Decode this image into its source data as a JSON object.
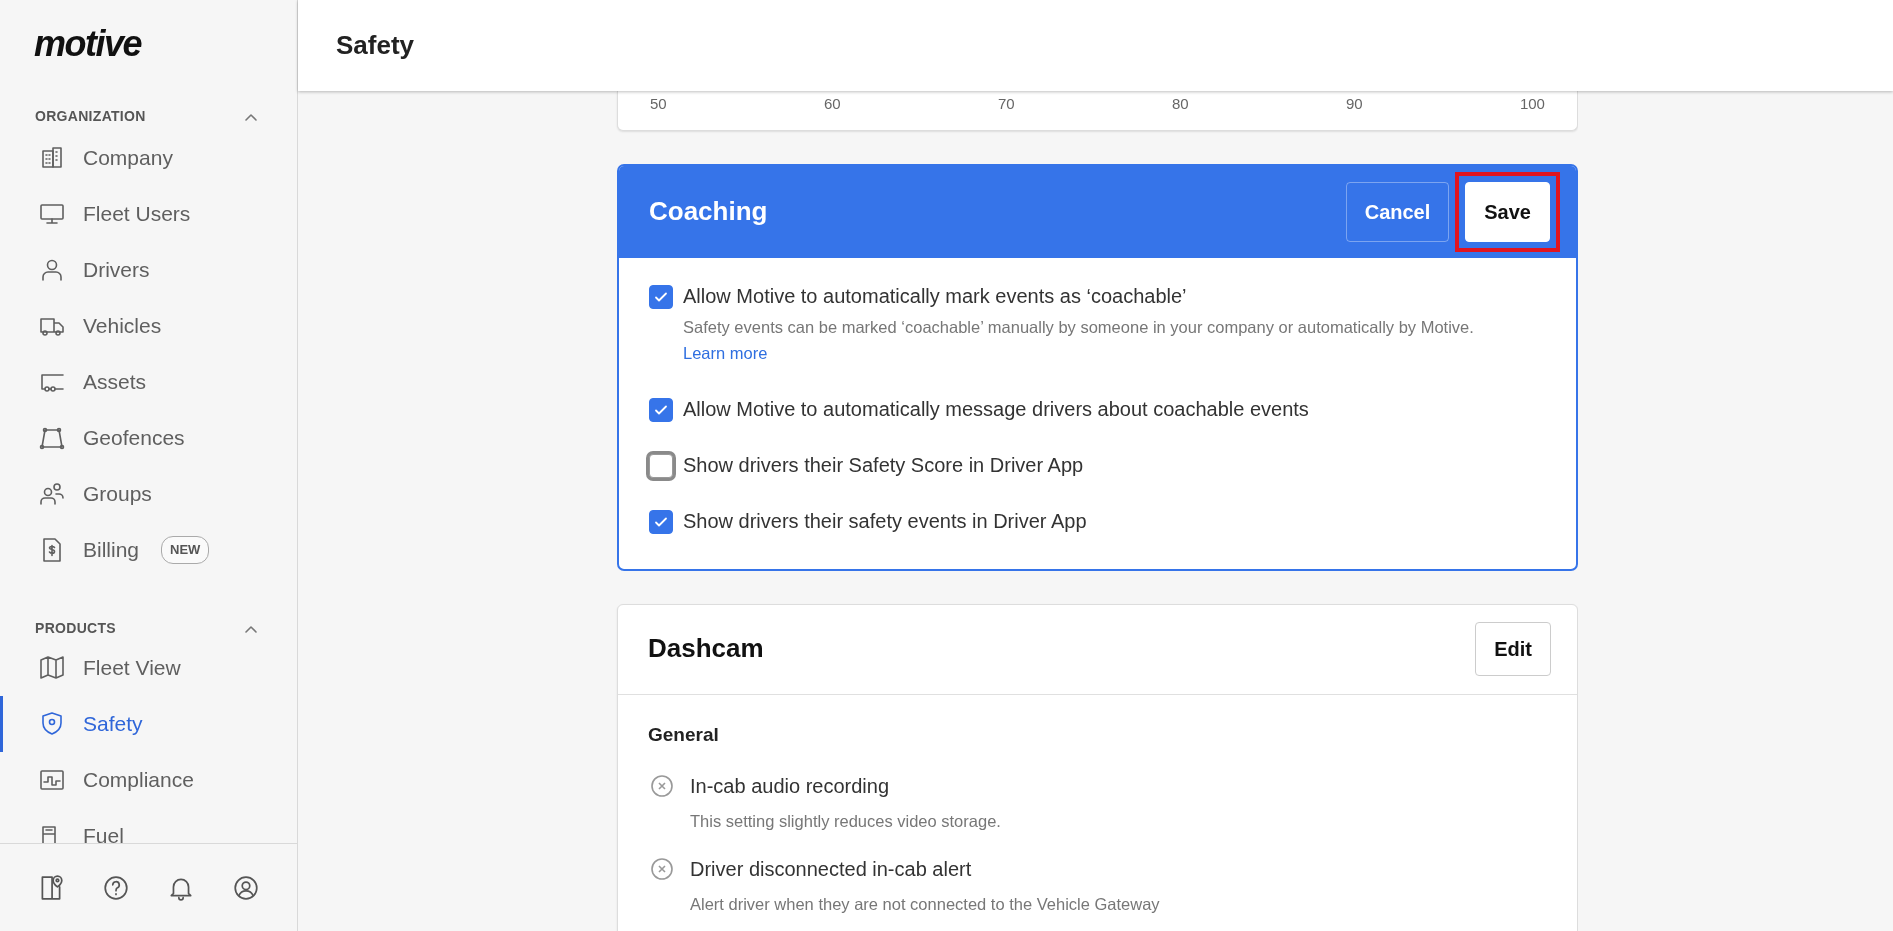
{
  "sidebar": {
    "logo": "motive",
    "sections": [
      {
        "title": "ORGANIZATION",
        "expanded": true,
        "items": [
          {
            "label": "Company",
            "selected": false
          },
          {
            "label": "Fleet Users",
            "selected": false
          },
          {
            "label": "Drivers",
            "selected": false
          },
          {
            "label": "Vehicles",
            "selected": false
          },
          {
            "label": "Assets",
            "selected": false
          },
          {
            "label": "Geofences",
            "selected": false
          },
          {
            "label": "Groups",
            "selected": false
          },
          {
            "label": "Billing",
            "selected": false,
            "badge": "NEW"
          }
        ]
      },
      {
        "title": "PRODUCTS",
        "expanded": true,
        "items": [
          {
            "label": "Fleet View",
            "selected": false
          },
          {
            "label": "Safety",
            "selected": true
          },
          {
            "label": "Compliance",
            "selected": false
          },
          {
            "label": "Fuel",
            "selected": false
          }
        ]
      }
    ]
  },
  "header": {
    "title": "Safety"
  },
  "score_card": {
    "axis_labels": [
      "50",
      "60",
      "70",
      "80",
      "90",
      "100"
    ]
  },
  "coaching": {
    "title": "Coaching",
    "buttons": [
      {
        "label": "Cancel",
        "kind": "secondary",
        "highlighted": false
      },
      {
        "label": "Save",
        "kind": "primary",
        "highlighted": true
      }
    ],
    "options": [
      {
        "label": "Allow Motive to automatically mark events as ‘coachable’",
        "checked": true,
        "description": "Safety events can be marked ‘coachable’ manually by someone in your company or automatically by Motive.",
        "link": "Learn more"
      },
      {
        "label": "Allow Motive to automatically message drivers about coachable events",
        "checked": true
      },
      {
        "label": "Show drivers their Safety Score in Driver App",
        "checked": false
      },
      {
        "label": "Show drivers their safety events in Driver App",
        "checked": true
      }
    ]
  },
  "dashcam": {
    "title": "Dashcam",
    "button": "Edit",
    "section": "General",
    "settings": [
      {
        "label": "In-cab audio recording",
        "enabled": false,
        "description": "This setting slightly reduces video storage."
      },
      {
        "label": "Driver disconnected in-cab alert",
        "enabled": false,
        "description": "Alert driver when they are not connected to the Vehicle Gateway"
      }
    ]
  }
}
